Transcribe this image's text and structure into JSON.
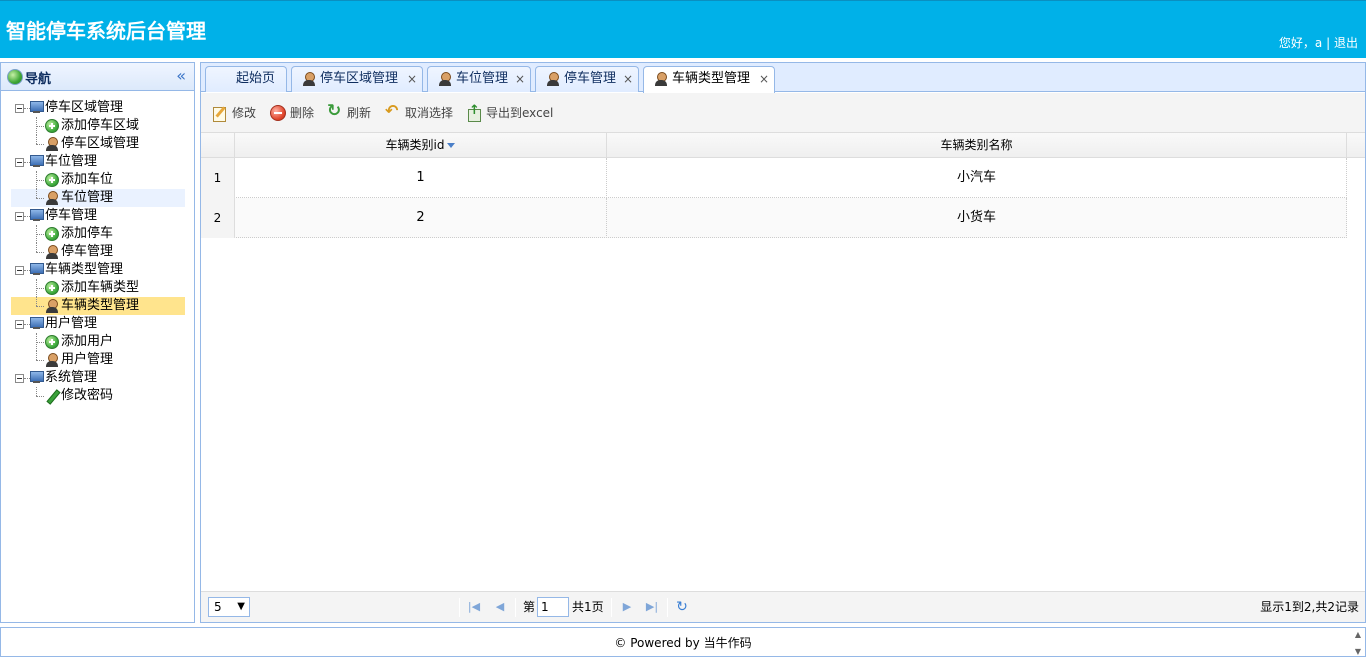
{
  "header": {
    "title": "智能停车系统后台管理",
    "greeting": "您好，a",
    "separator": "|",
    "logout": "退出"
  },
  "nav": {
    "title": "导航",
    "groups": [
      {
        "label": "停车区域管理",
        "items": [
          "添加停车区域",
          "停车区域管理"
        ]
      },
      {
        "label": "车位管理",
        "items": [
          "添加车位",
          "车位管理"
        ]
      },
      {
        "label": "停车管理",
        "items": [
          "添加停车",
          "停车管理"
        ]
      },
      {
        "label": "车辆类型管理",
        "items": [
          "添加车辆类型",
          "车辆类型管理"
        ]
      },
      {
        "label": "用户管理",
        "items": [
          "添加用户",
          "用户管理"
        ]
      },
      {
        "label": "系统管理",
        "items": [
          "修改密码"
        ]
      }
    ],
    "selected": "车辆类型管理"
  },
  "tabs": [
    {
      "label": "起始页",
      "closable": false
    },
    {
      "label": "停车区域管理",
      "closable": true
    },
    {
      "label": "车位管理",
      "closable": true
    },
    {
      "label": "停车管理",
      "closable": true
    },
    {
      "label": "车辆类型管理",
      "closable": true,
      "active": true
    }
  ],
  "toolbar": {
    "edit": "修改",
    "remove": "删除",
    "refresh": "刷新",
    "cancel_select": "取消选择",
    "export": "导出到excel"
  },
  "grid": {
    "columns": [
      "车辆类别id",
      "车辆类别名称"
    ],
    "rows": [
      {
        "num": "1",
        "id": "1",
        "name": "小汽车"
      },
      {
        "num": "2",
        "id": "2",
        "name": "小货车"
      }
    ]
  },
  "pager": {
    "page_size": "5",
    "page_prefix": "第",
    "page_value": "1",
    "total_pages": "共1页",
    "info": "显示1到2,共2记录"
  },
  "footer": {
    "powered": "© Powered by 当牛作码"
  }
}
